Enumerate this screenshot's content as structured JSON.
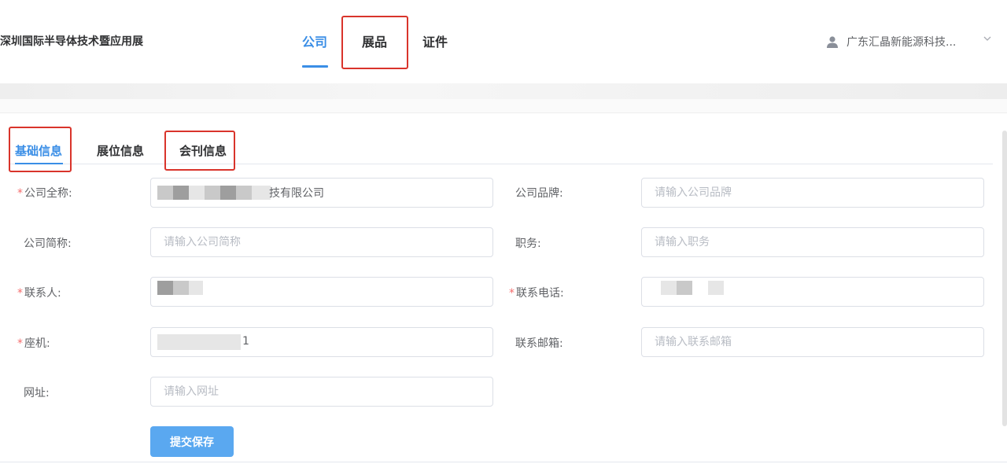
{
  "header": {
    "site_title": "深圳国际半导体技术暨应用展",
    "nav_tabs": [
      {
        "label": "公司",
        "active": true
      },
      {
        "label": "展品",
        "active": false
      },
      {
        "label": "证件",
        "active": false
      }
    ],
    "user_name": "广东汇晶新能源科技...",
    "user_icon": "user-icon",
    "dropdown_icon": "chevron-down-icon"
  },
  "subtabs": [
    {
      "label": "基础信息",
      "active": true
    },
    {
      "label": "展位信息",
      "active": false
    },
    {
      "label": "会刊信息",
      "active": false
    }
  ],
  "form": {
    "company_full_name": {
      "label": "公司全称:",
      "required": true,
      "value": "技有限公司"
    },
    "company_brand": {
      "label": "公司品牌:",
      "required": false,
      "placeholder": "请输入公司品牌"
    },
    "company_short_name": {
      "label": "公司简称:",
      "required": false,
      "placeholder": "请输入公司简称"
    },
    "position": {
      "label": "职务:",
      "required": false,
      "placeholder": "请输入职务"
    },
    "contact_person": {
      "label": "联系人:",
      "required": true,
      "value": ""
    },
    "contact_phone": {
      "label": "联系电话:",
      "required": true,
      "value": ""
    },
    "landline": {
      "label": "座机:",
      "required": true,
      "value": "1"
    },
    "contact_email": {
      "label": "联系邮箱:",
      "required": false,
      "placeholder": "请输入联系邮箱"
    },
    "website": {
      "label": "网址:",
      "required": false,
      "placeholder": "请输入网址"
    },
    "required_mark": "*",
    "submit_label": "提交保存"
  },
  "colors": {
    "accent": "#3a8ee6",
    "button": "#5aa8f0",
    "highlight_box": "#d9342b",
    "required": "#f56c6c"
  }
}
